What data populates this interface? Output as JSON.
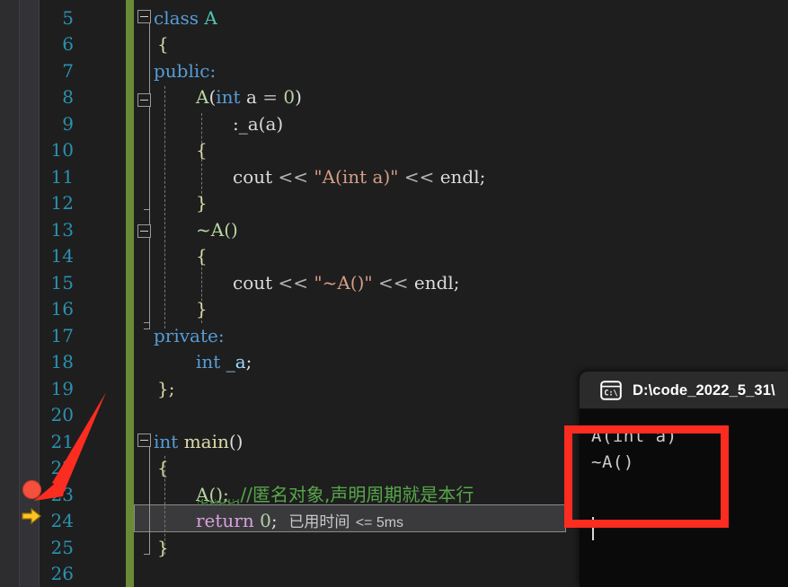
{
  "editor": {
    "theme": "visual-studio-dark",
    "first_visible_line": 5,
    "gutter": {
      "breakpoint_line": 23,
      "execution_line": 24,
      "breakpoint_icon": "breakpoint-dot-icon",
      "execution_icon": "execution-arrow-icon"
    },
    "line_numbers": [
      "5",
      "6",
      "7",
      "8",
      "9",
      "10",
      "11",
      "12",
      "13",
      "14",
      "15",
      "16",
      "17",
      "18",
      "19",
      "20",
      "21",
      "22",
      "23",
      "24",
      "25",
      "26"
    ],
    "lines": [
      {
        "number": "5",
        "text": "class A"
      },
      {
        "number": "6",
        "text": "{"
      },
      {
        "number": "7",
        "text": "public:"
      },
      {
        "number": "8",
        "text": "A(int a = 0)"
      },
      {
        "number": "9",
        "text": ":_a(a)"
      },
      {
        "number": "10",
        "text": "{"
      },
      {
        "number": "11",
        "text": "cout << \"A(int a)\" << endl;"
      },
      {
        "number": "12",
        "text": "}"
      },
      {
        "number": "13",
        "text": "~A()"
      },
      {
        "number": "14",
        "text": "{"
      },
      {
        "number": "15",
        "text": "cout << \"~A()\" << endl;"
      },
      {
        "number": "16",
        "text": "}"
      },
      {
        "number": "17",
        "text": "private:"
      },
      {
        "number": "18",
        "text": "int _a;"
      },
      {
        "number": "19",
        "text": "};"
      },
      {
        "number": "20",
        "text": ""
      },
      {
        "number": "21",
        "text": "int main()"
      },
      {
        "number": "22",
        "text": "{"
      },
      {
        "number": "23",
        "text": "A(); //匿名对象,声明周期就是本行"
      },
      {
        "number": "24",
        "text": "return 0;"
      },
      {
        "number": "25",
        "text": "}"
      },
      {
        "number": "26",
        "text": ""
      }
    ],
    "tokens": {
      "kw_class": "class",
      "name_A": "A",
      "brace_open": "{",
      "brace_close": "}",
      "kw_public": "public:",
      "kw_private": "private:",
      "ctor_sig_name": "A",
      "ctor_paren_open": "(",
      "kw_int": "int",
      "param_a": "a",
      "op_eq": "=",
      "num_zero": "0",
      "ctor_paren_close": ")",
      "init_list": ":_a(a)",
      "cout": "cout",
      "shift": "<<",
      "str_ctor": "\"A(int a)\"",
      "str_dtor": "\"~A()\"",
      "endl": "endl",
      "semi": ";",
      "dtor_tilde_name": "~A()",
      "member_decl": "int _a;",
      "class_end": "};",
      "main_int": "int",
      "main_name": "main",
      "main_parens": "()",
      "anon_obj": "A();",
      "comment_cn": "//匿名对象,声明周期就是本行",
      "kw_return": "return",
      "return_value": "0",
      "return_semi": ";"
    },
    "inline_hint": {
      "label": "已用时间",
      "value": "<= 5ms"
    },
    "colors": {
      "background": "#1e1e1e",
      "line_number": "#2b91af",
      "keyword": "#569cd6",
      "class_name": "#b8d7a3",
      "string": "#d69d85",
      "number": "#b5cea8",
      "comment": "#57a64a",
      "control_keyword": "#d8a0df",
      "change_bar": "#6a8a36",
      "identifier": "#dadada",
      "breakpoint": "#f4503c",
      "execution_arrow": "#ffc425"
    }
  },
  "console": {
    "title": "D:\\code_2022_5_31\\",
    "icon": "console-cmd-icon",
    "output": [
      "A(int a)",
      "~A()"
    ],
    "background": "#000000",
    "titlebar_background": "#2b2b2b"
  },
  "annotations": {
    "arrow": {
      "name": "red-annotation-arrow",
      "color": "#fb2c20",
      "points_to_line": "23"
    },
    "rect": {
      "name": "red-annotation-rectangle",
      "color": "#fb2c20",
      "highlights": "console output"
    }
  }
}
